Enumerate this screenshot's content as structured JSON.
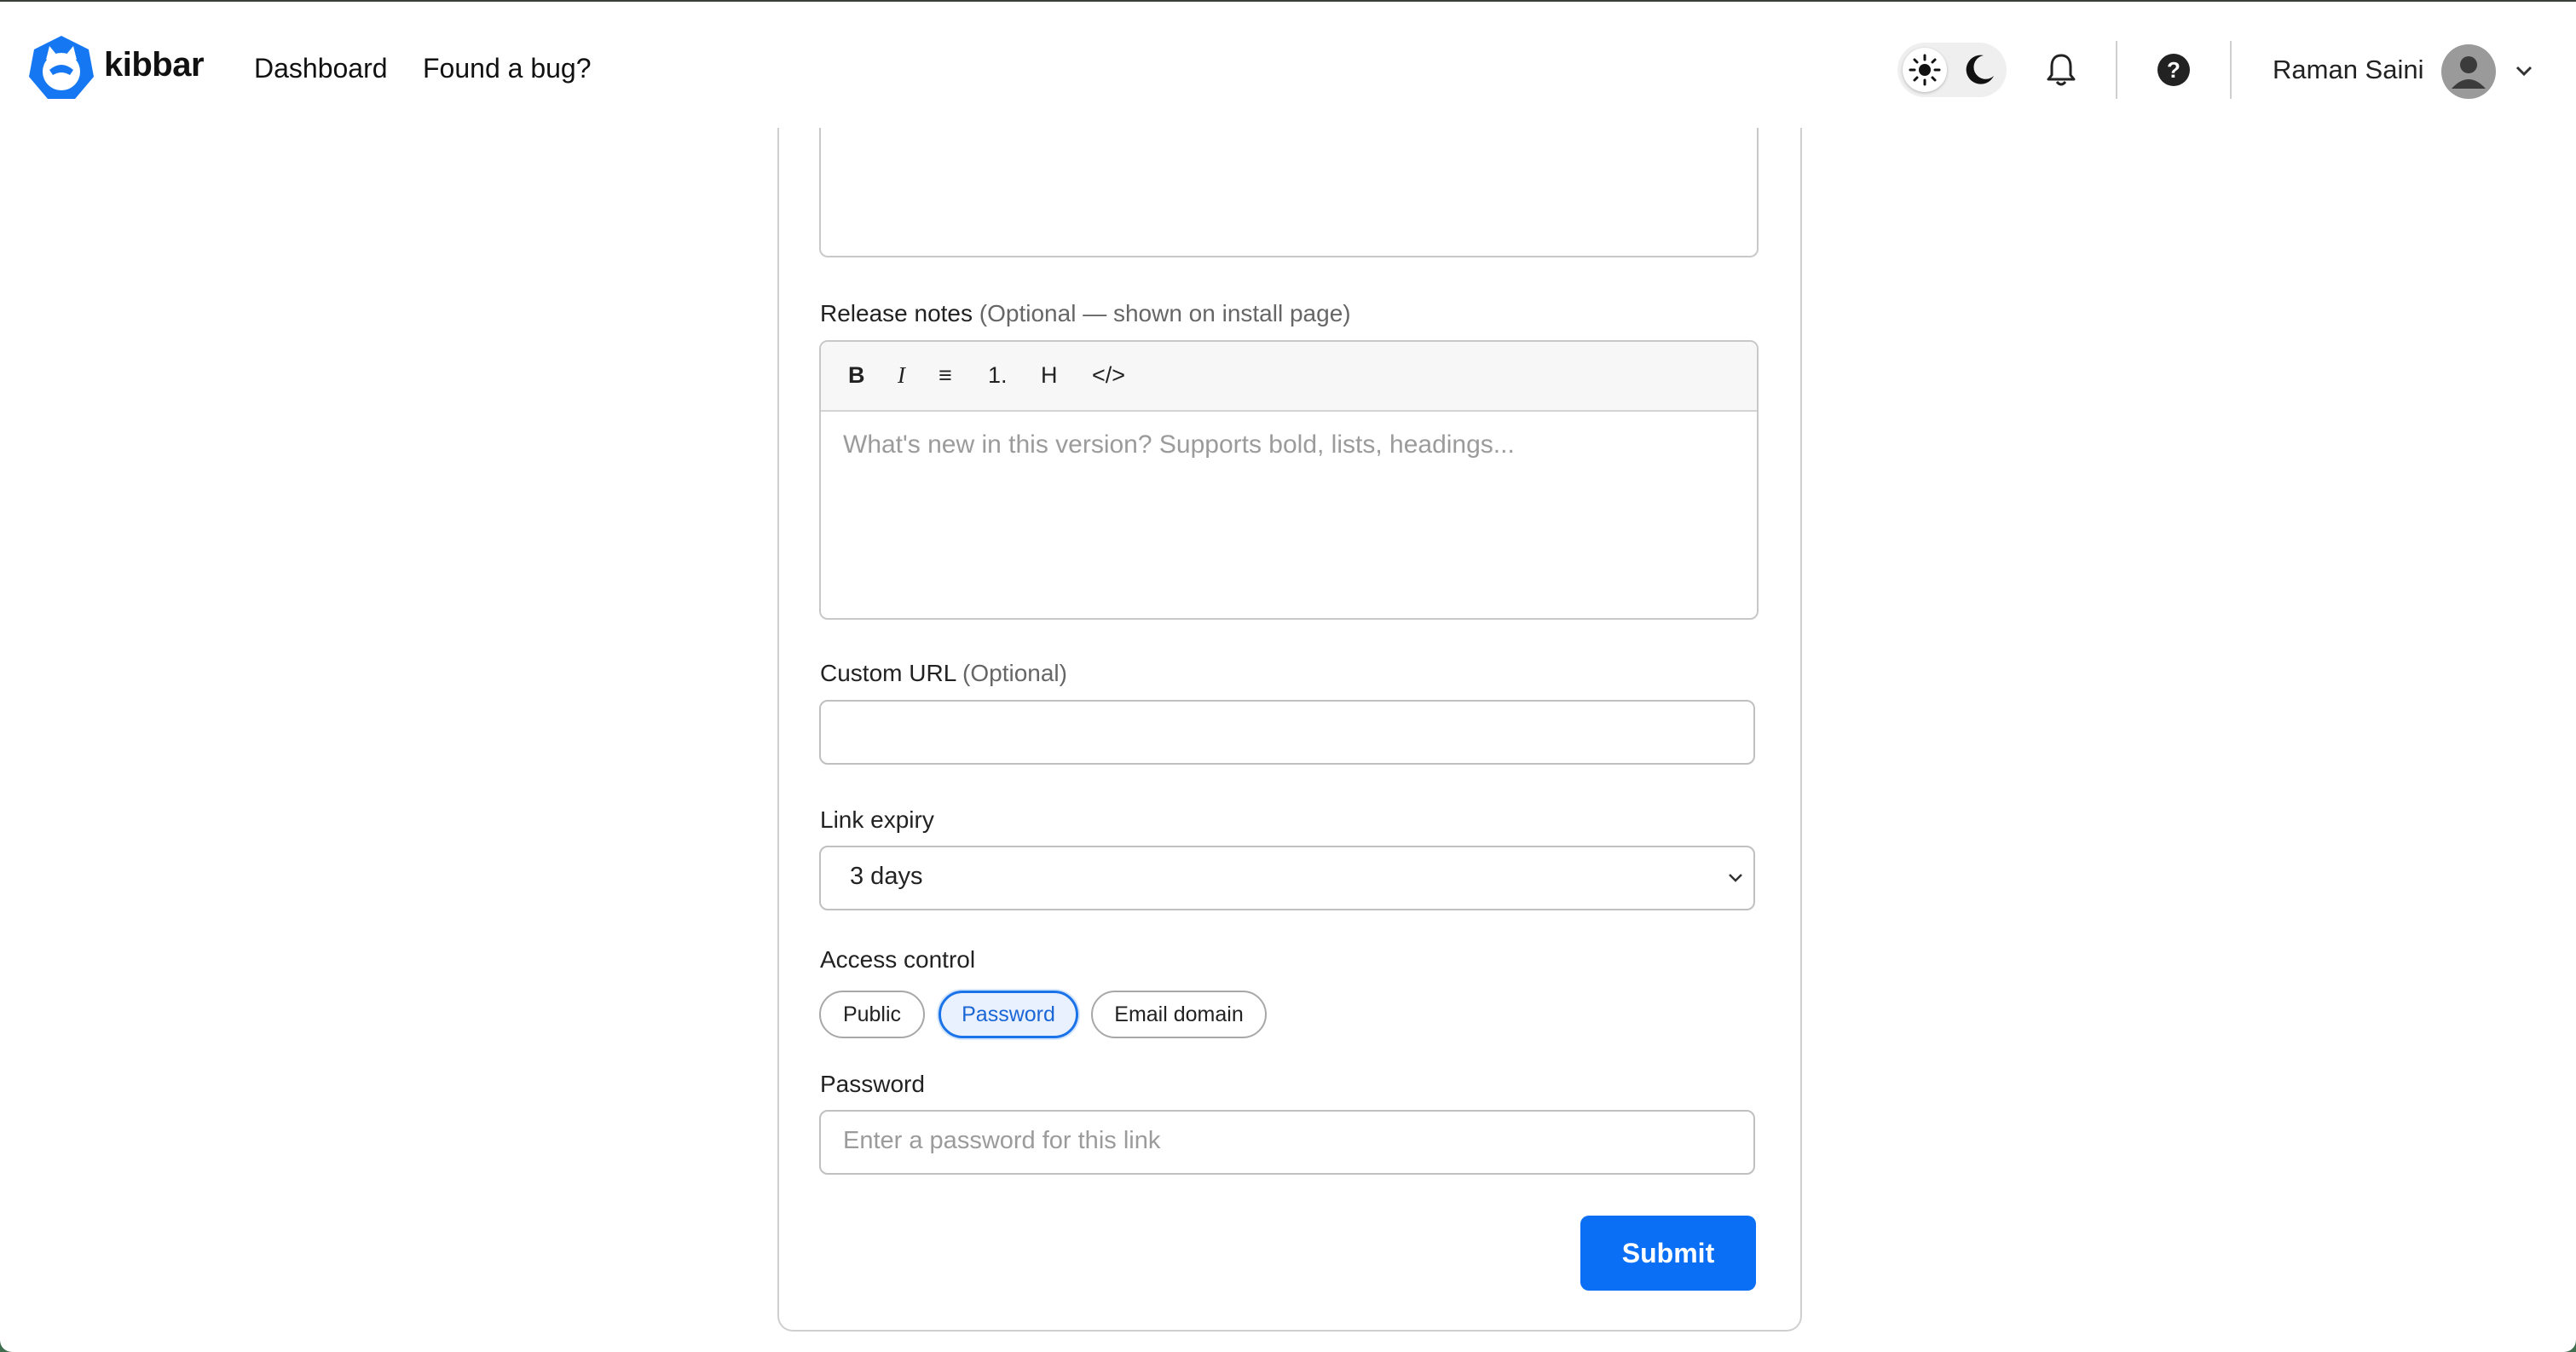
{
  "colors": {
    "accent": "#0a6ff5",
    "active_pill_bg": "#e8f1fd",
    "border": "#c8c8c8"
  },
  "header": {
    "brand": "kibbar",
    "nav": {
      "dashboard": "Dashboard",
      "bug": "Found a bug?"
    },
    "theme_options": [
      "sun-icon",
      "moon-icon"
    ],
    "user_name": "Raman Saini"
  },
  "form": {
    "release_notes": {
      "label": "Release notes",
      "optional_note": "(Optional — shown on install page)",
      "toolbar": [
        "B",
        "I",
        "≡",
        "1.",
        "H",
        "</>"
      ],
      "placeholder": "What's new in this version? Supports bold, lists, headings..."
    },
    "custom_url": {
      "label": "Custom URL",
      "optional_note": "(Optional)",
      "value": ""
    },
    "link_expiry": {
      "label": "Link expiry",
      "value": "3 days"
    },
    "access_control": {
      "label": "Access control",
      "options": [
        "Public",
        "Password",
        "Email domain"
      ],
      "selected": "Password"
    },
    "password": {
      "label": "Password",
      "placeholder": "Enter a password for this link"
    },
    "submit_label": "Submit"
  }
}
